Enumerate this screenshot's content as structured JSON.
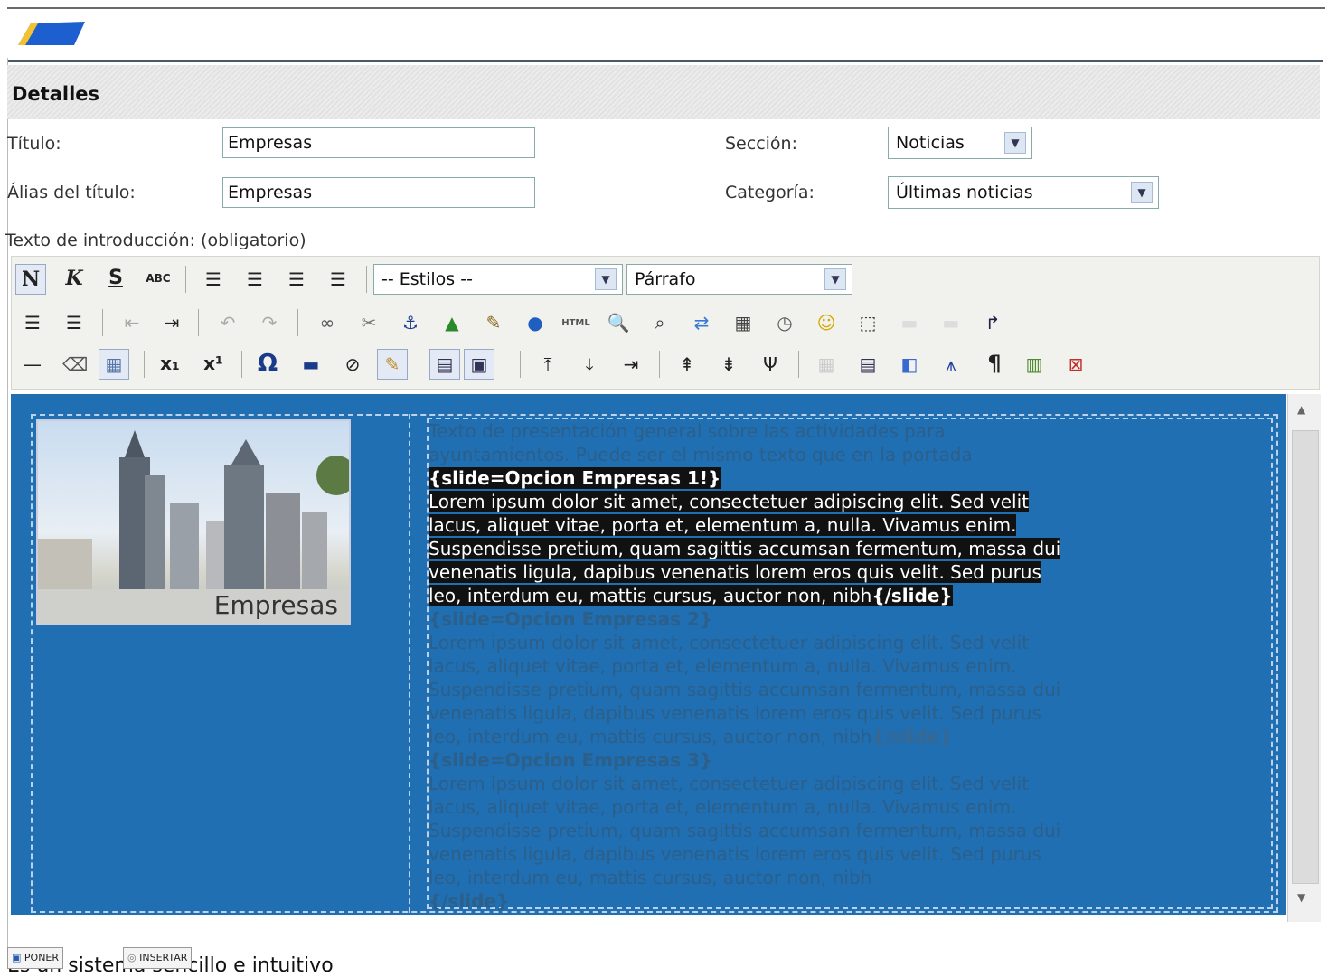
{
  "details": {
    "title": "Detalles",
    "titulo_label": "Título:",
    "titulo_value": "Empresas",
    "alias_label": "Álias del título:",
    "alias_value": "Empresas",
    "seccion_label": "Sección:",
    "seccion_value": "Noticias",
    "categoria_label": "Categoría:",
    "categoria_value": "Últimas noticias",
    "intro_label": "Texto de introducción: (obligatorio)"
  },
  "toolbar": {
    "bold": "N",
    "italic": "K",
    "strike": "S",
    "spell": "ABC",
    "styles_value": "-- Estilos --",
    "format_value": "Párrafo",
    "omega": "Ω",
    "subscript": "x₁",
    "superscript": "x¹",
    "pilcrow": "¶",
    "html": "HTML"
  },
  "editor": {
    "photo_caption": "Empresas",
    "intro_line1": "Texto de presentación general sobre las actividades para",
    "intro_line2": "ayuntamientos. Puede ser el mismo texto que en la portada",
    "slide1_open": "{slide=Opcion Empresas 1!}",
    "slide1_l1": "Lorem ipsum dolor sit amet, consectetuer adipiscing elit. Sed velit",
    "slide1_l2": "lacus, aliquet vitae, porta et, elementum a, nulla. Vivamus enim.",
    "slide1_l3": "Suspendisse pretium, quam sagittis accumsan fermentum, massa dui",
    "slide1_l4": "venenatis ligula, dapibus venenatis lorem eros quis velit. Sed purus",
    "slide1_l5": "leo, interdum eu, mattis cursus, auctor non, nibh",
    "slide1_close": "{/slide}",
    "slide2_open": "{slide=Opcion Empresas 2}",
    "slide2_l1": "Lorem ipsum dolor sit amet, consectetuer adipiscing elit. Sed velit",
    "slide2_l2": "lacus, aliquet vitae, porta et, elementum a, nulla. Vivamus enim.",
    "slide2_l3": "Suspendisse pretium, quam sagittis accumsan fermentum, massa dui",
    "slide2_l4": "venenatis ligula, dapibus venenatis lorem eros quis velit. Sed purus",
    "slide2_l5": "leo, interdum eu, mattis cursus, auctor non, nibh",
    "slide2_close": "{/slide}",
    "slide3_open": "{slide=Opcion Empresas 3}",
    "slide3_l1": "Lorem ipsum dolor sit amet, consectetuer adipiscing elit. Sed velit",
    "slide3_l2": "lacus, aliquet vitae, porta et, elementum a, nulla. Vivamus enim.",
    "slide3_l3": "Suspendisse pretium, quam sagittis accumsan fermentum, massa dui",
    "slide3_l4": "venenatis ligula, dapibus venenatis lorem eros quis velit. Sed purus",
    "slide3_l5": "leo, interdum eu, mattis cursus, auctor non, nibh",
    "slide3_close": "{/slide}"
  },
  "bottom": {
    "poner": "PONER",
    "insertar": "INSERTAR",
    "caption": "Es un sistema sencillo e intuitivo"
  }
}
